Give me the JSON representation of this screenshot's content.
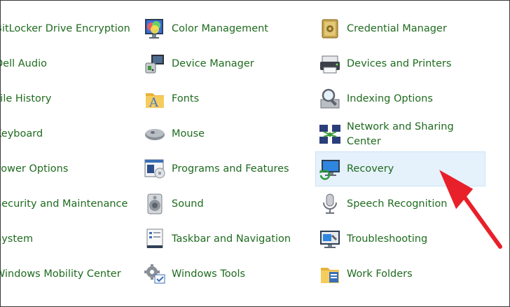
{
  "columns": [
    [
      {
        "label": "BitLocker Drive Encryption",
        "icon": "bitlocker-icon"
      },
      {
        "label": "Dell Audio",
        "icon": "dell-audio-icon"
      },
      {
        "label": "File History",
        "icon": "file-history-icon"
      },
      {
        "label": "Keyboard",
        "icon": "keyboard-icon"
      },
      {
        "label": "Power Options",
        "icon": "power-options-icon"
      },
      {
        "label": "Security and Maintenance",
        "icon": "security-maintenance-icon"
      },
      {
        "label": "System",
        "icon": "system-icon"
      },
      {
        "label": "Windows Mobility Center",
        "icon": "mobility-center-icon"
      }
    ],
    [
      {
        "label": "Color Management",
        "icon": "color-management-icon"
      },
      {
        "label": "Device Manager",
        "icon": "device-manager-icon"
      },
      {
        "label": "Fonts",
        "icon": "fonts-icon"
      },
      {
        "label": "Mouse",
        "icon": "mouse-icon"
      },
      {
        "label": "Programs and Features",
        "icon": "programs-features-icon"
      },
      {
        "label": "Sound",
        "icon": "sound-icon"
      },
      {
        "label": "Taskbar and Navigation",
        "icon": "taskbar-navigation-icon"
      },
      {
        "label": "Windows Tools",
        "icon": "windows-tools-icon"
      }
    ],
    [
      {
        "label": "Credential Manager",
        "icon": "credential-manager-icon"
      },
      {
        "label": "Devices and Printers",
        "icon": "devices-printers-icon"
      },
      {
        "label": "Indexing Options",
        "icon": "indexing-options-icon"
      },
      {
        "label": "Network and Sharing Center",
        "icon": "network-sharing-icon"
      },
      {
        "label": "Recovery",
        "icon": "recovery-icon",
        "highlighted": true
      },
      {
        "label": "Speech Recognition",
        "icon": "microphone-icon"
      },
      {
        "label": "Troubleshooting",
        "icon": "troubleshooting-icon"
      },
      {
        "label": "Work Folders",
        "icon": "work-folders-icon"
      }
    ]
  ],
  "colors": {
    "link": "#1f6b1f",
    "highlight": "#e5f1fb",
    "annotation_arrow": "#e8202a"
  }
}
